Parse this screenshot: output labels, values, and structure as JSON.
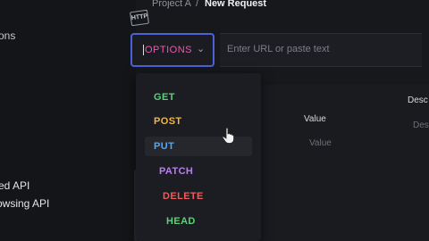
{
  "sidebar": {
    "items": [
      {
        "label": "ons"
      },
      {
        "label": "ed API"
      },
      {
        "label": "owsing API"
      }
    ]
  },
  "header": {
    "icon_text": "HTTP",
    "project": "Project A",
    "separator": "/",
    "title": "New Request"
  },
  "request": {
    "method": "OPTIONS",
    "url_placeholder": "Enter URL or paste text"
  },
  "method_options": [
    "GET",
    "POST",
    "PUT",
    "PATCH",
    "DELETE",
    "HEAD"
  ],
  "params_table": {
    "headers": {
      "value": "Value",
      "description": "Desc"
    },
    "placeholders": {
      "value": "Value",
      "description": "Desc"
    }
  },
  "colors": {
    "accent_border": "#4a62d6",
    "options": "#e45ab0",
    "get": "#5fcf7a",
    "post": "#f0b64a",
    "put": "#56a7ee",
    "patch": "#b97ff0",
    "delete": "#ef5b5b",
    "head": "#5fcf7a"
  }
}
